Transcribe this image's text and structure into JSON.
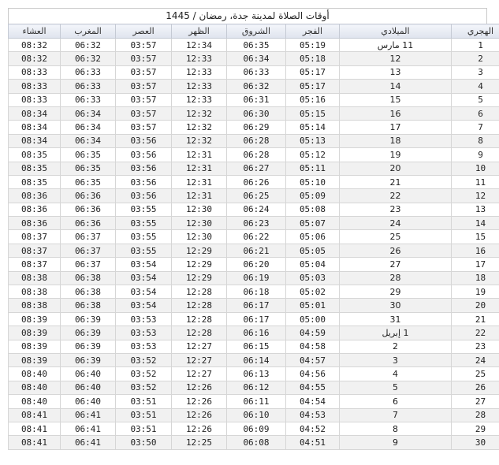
{
  "title": "أوقات الصلاة لمدينة جدة، رمضان / 1445",
  "headers": [
    "الهجري",
    "الميلادي",
    "الفجر",
    "الشروق",
    "الظهر",
    "العصر",
    "المغرب",
    "العشاء"
  ],
  "rows": [
    [
      "1",
      "11 مارس",
      "05:19",
      "06:35",
      "12:34",
      "03:57",
      "06:32",
      "08:32"
    ],
    [
      "2",
      "12",
      "05:18",
      "06:34",
      "12:33",
      "03:57",
      "06:32",
      "08:32"
    ],
    [
      "3",
      "13",
      "05:17",
      "06:33",
      "12:33",
      "03:57",
      "06:33",
      "08:33"
    ],
    [
      "4",
      "14",
      "05:17",
      "06:32",
      "12:33",
      "03:57",
      "06:33",
      "08:33"
    ],
    [
      "5",
      "15",
      "05:16",
      "06:31",
      "12:33",
      "03:57",
      "06:33",
      "08:33"
    ],
    [
      "6",
      "16",
      "05:15",
      "06:30",
      "12:32",
      "03:57",
      "06:34",
      "08:34"
    ],
    [
      "7",
      "17",
      "05:14",
      "06:29",
      "12:32",
      "03:57",
      "06:34",
      "08:34"
    ],
    [
      "8",
      "18",
      "05:13",
      "06:28",
      "12:32",
      "03:56",
      "06:34",
      "08:34"
    ],
    [
      "9",
      "19",
      "05:12",
      "06:28",
      "12:31",
      "03:56",
      "06:35",
      "08:35"
    ],
    [
      "10",
      "20",
      "05:11",
      "06:27",
      "12:31",
      "03:56",
      "06:35",
      "08:35"
    ],
    [
      "11",
      "21",
      "05:10",
      "06:26",
      "12:31",
      "03:56",
      "06:35",
      "08:35"
    ],
    [
      "12",
      "22",
      "05:09",
      "06:25",
      "12:31",
      "03:56",
      "06:36",
      "08:36"
    ],
    [
      "13",
      "23",
      "05:08",
      "06:24",
      "12:30",
      "03:55",
      "06:36",
      "08:36"
    ],
    [
      "14",
      "24",
      "05:07",
      "06:23",
      "12:30",
      "03:55",
      "06:36",
      "08:36"
    ],
    [
      "15",
      "25",
      "05:06",
      "06:22",
      "12:30",
      "03:55",
      "06:37",
      "08:37"
    ],
    [
      "16",
      "26",
      "05:05",
      "06:21",
      "12:29",
      "03:55",
      "06:37",
      "08:37"
    ],
    [
      "17",
      "27",
      "05:04",
      "06:20",
      "12:29",
      "03:54",
      "06:37",
      "08:37"
    ],
    [
      "18",
      "28",
      "05:03",
      "06:19",
      "12:29",
      "03:54",
      "06:38",
      "08:38"
    ],
    [
      "19",
      "29",
      "05:02",
      "06:18",
      "12:28",
      "03:54",
      "06:38",
      "08:38"
    ],
    [
      "20",
      "30",
      "05:01",
      "06:17",
      "12:28",
      "03:54",
      "06:38",
      "08:38"
    ],
    [
      "21",
      "31",
      "05:00",
      "06:17",
      "12:28",
      "03:53",
      "06:39",
      "08:39"
    ],
    [
      "22",
      "1 إبريل",
      "04:59",
      "06:16",
      "12:28",
      "03:53",
      "06:39",
      "08:39"
    ],
    [
      "23",
      "2",
      "04:58",
      "06:15",
      "12:27",
      "03:53",
      "06:39",
      "08:39"
    ],
    [
      "24",
      "3",
      "04:57",
      "06:14",
      "12:27",
      "03:52",
      "06:39",
      "08:39"
    ],
    [
      "25",
      "4",
      "04:56",
      "06:13",
      "12:27",
      "03:52",
      "06:40",
      "08:40"
    ],
    [
      "26",
      "5",
      "04:55",
      "06:12",
      "12:26",
      "03:52",
      "06:40",
      "08:40"
    ],
    [
      "27",
      "6",
      "04:54",
      "06:11",
      "12:26",
      "03:51",
      "06:40",
      "08:40"
    ],
    [
      "28",
      "7",
      "04:53",
      "06:10",
      "12:26",
      "03:51",
      "06:41",
      "08:41"
    ],
    [
      "29",
      "8",
      "04:52",
      "06:09",
      "12:26",
      "03:51",
      "06:41",
      "08:41"
    ],
    [
      "30",
      "9",
      "04:51",
      "06:08",
      "12:25",
      "03:50",
      "06:41",
      "08:41"
    ]
  ]
}
